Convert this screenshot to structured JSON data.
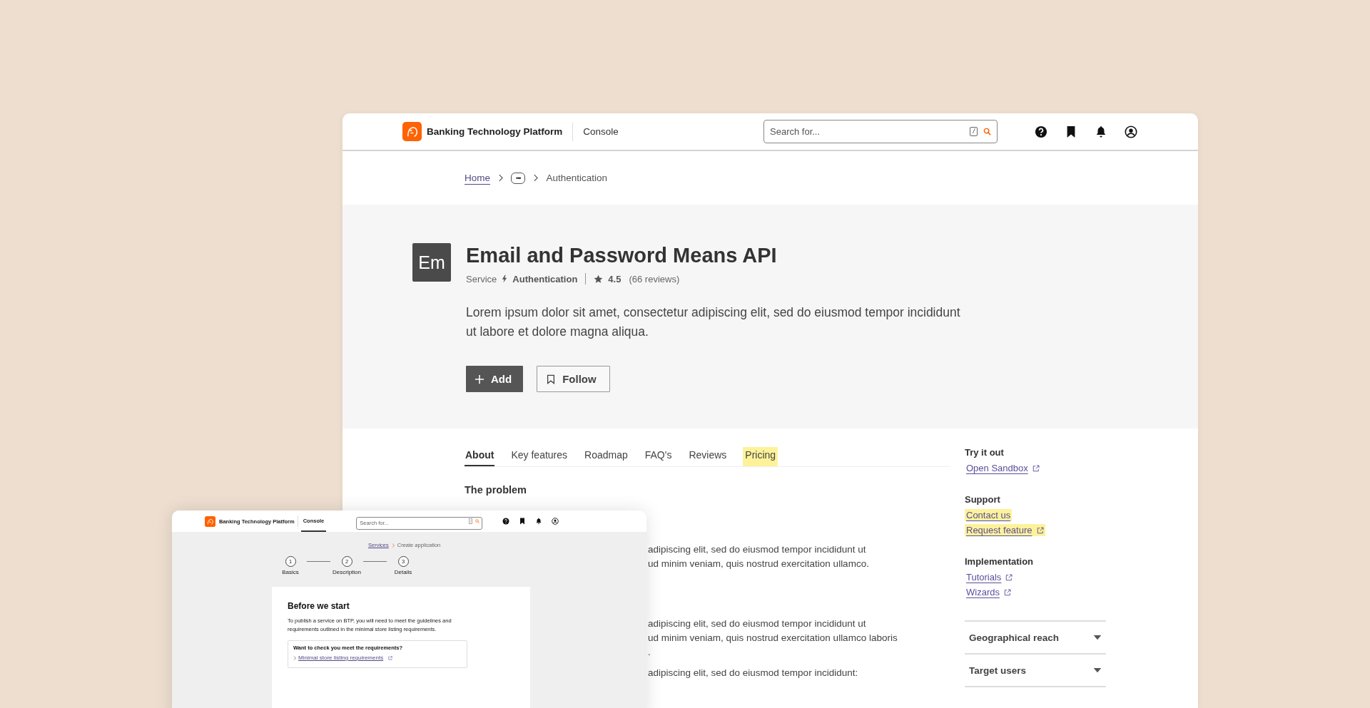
{
  "main_window": {
    "header": {
      "brand": "Banking Technology Platform",
      "section": "Console",
      "search": {
        "placeholder": "Search for...",
        "shortcut": "/"
      }
    },
    "breadcrumb": [
      {
        "label": "Home",
        "kind": "link"
      },
      {
        "label": "•••",
        "kind": "more"
      },
      {
        "label": "Authentication",
        "kind": "current"
      }
    ],
    "product": {
      "initials": "Em",
      "title": "Email and Password Means API",
      "type": "Service",
      "category": "Authentication",
      "rating": "4.5",
      "reviews": "(66 reviews)",
      "description": "Lorem ipsum dolor sit amet, consectetur adipiscing elit, sed do eiusmod tempor incididunt ut labore et dolore magna aliqua.",
      "buttons": [
        {
          "label": "Add",
          "kind": "primary"
        },
        {
          "label": "Follow",
          "kind": "secondary"
        }
      ]
    },
    "tabs": [
      {
        "label": "About",
        "selected": true,
        "highlighted": false
      },
      {
        "label": "Key features",
        "selected": false,
        "highlighted": false
      },
      {
        "label": "Roadmap",
        "selected": false,
        "highlighted": false
      },
      {
        "label": "FAQ's",
        "selected": false,
        "highlighted": false
      },
      {
        "label": "Reviews",
        "selected": false,
        "highlighted": false
      },
      {
        "label": "Pricing",
        "selected": false,
        "highlighted": true
      }
    ],
    "content": {
      "heading": "The problem",
      "paragraphs": [
        {
          "lines": [
            "adipiscing elit, sed do eiusmod tempor incididunt ut",
            "ud minim veniam, quis nostrud exercitation ullamco."
          ]
        },
        {
          "lines": [
            "adipiscing elit, sed do eiusmod tempor incididunt ut",
            "ud minim veniam, quis nostrud exercitation ullamco laboris",
            "."
          ]
        },
        {
          "lines": [
            "adipiscing elit, sed do eiusmod tempor incididunt:"
          ]
        }
      ]
    },
    "sidebar": {
      "sections": [
        {
          "title": "Try it out",
          "links": [
            {
              "label": "Open Sandbox",
              "external": true,
              "highlighted": false
            }
          ]
        },
        {
          "title": "Support",
          "links": [
            {
              "label": "Contact us",
              "external": false,
              "highlighted": true
            },
            {
              "label": "Request feature",
              "external": true,
              "highlighted": true
            }
          ]
        },
        {
          "title": "Implementation",
          "links": [
            {
              "label": "Tutorials",
              "external": true,
              "highlighted": false
            },
            {
              "label": "Wizards",
              "external": true,
              "highlighted": false
            }
          ]
        }
      ],
      "accordions": [
        {
          "label": "Geographical reach",
          "expanded": false
        },
        {
          "label": "Target users",
          "expanded": false
        }
      ]
    }
  },
  "overlay_window": {
    "header": {
      "brand": "Banking Technology Platform",
      "tabs": [
        {
          "label": "Console",
          "selected": true
        }
      ],
      "search": {
        "placeholder": "Search for...",
        "shortcut": "/"
      }
    },
    "breadcrumb": [
      {
        "label": "Services",
        "kind": "link"
      },
      {
        "label": "Create application",
        "kind": "current"
      }
    ],
    "steps": [
      {
        "number": "1",
        "label": "Basics"
      },
      {
        "number": "2",
        "label": "Description"
      },
      {
        "number": "3",
        "label": "Details"
      }
    ],
    "card": {
      "title": "Before we start",
      "text": "To publish a service on BTP, you will need to meet the guidelines and requirements outlined in the minimal store listing requirements.",
      "callout": {
        "title": "Want to check you meet the requirements?",
        "link": "Minimal store listing requirements"
      }
    }
  }
}
